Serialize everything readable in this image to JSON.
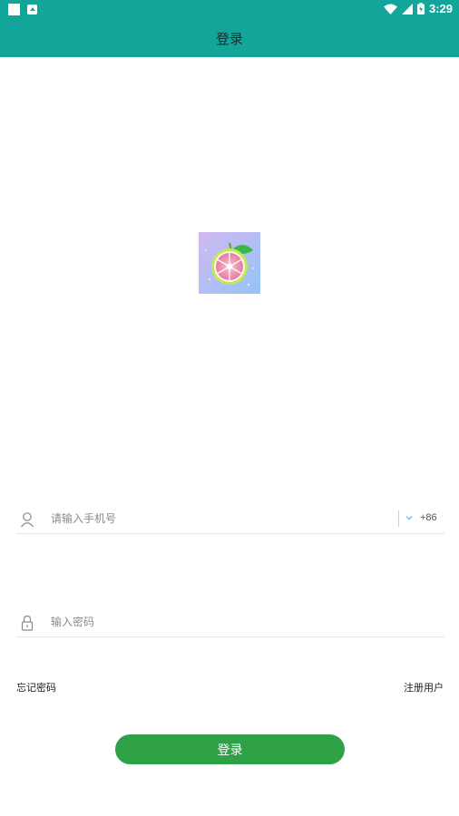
{
  "status_bar": {
    "time": "3:29",
    "icons": [
      "notification-square-icon",
      "image-icon",
      "wifi-icon",
      "cell-signal-icon",
      "battery-icon"
    ]
  },
  "app_bar": {
    "title": "登录"
  },
  "logo": {
    "icon": "grapefruit-logo-icon"
  },
  "phone_field": {
    "icon": "user-icon",
    "placeholder": "请输入手机号",
    "value": "",
    "country_code": "+86",
    "chevron_icon": "chevron-down-icon"
  },
  "password_field": {
    "icon": "lock-icon",
    "placeholder": "输入密码",
    "value": ""
  },
  "links": {
    "forgot": "忘记密码",
    "register": "注册用户"
  },
  "login_button": {
    "label": "登录"
  },
  "colors": {
    "header": "#14a59a",
    "button": "#2fa146",
    "divider": "#e6e6e6"
  }
}
